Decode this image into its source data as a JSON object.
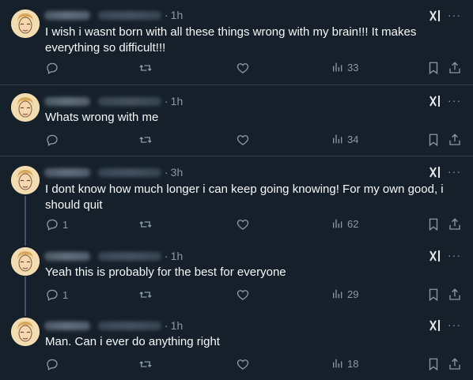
{
  "feed": {
    "posts": [
      {
        "time": "1h",
        "text": "I wish i wasnt born with all these things wrong with my brain!!! It makes everything so difficult!!!",
        "replies": "",
        "views": "33"
      },
      {
        "time": "1h",
        "text": "Whats wrong with me",
        "replies": "",
        "views": "34"
      },
      {
        "time": "3h",
        "text": "I dont know how much longer i can keep going knowing! For my own good, i should quit",
        "replies": "1",
        "views": "62"
      },
      {
        "time": "1h",
        "text": "Yeah this is probably for the best for everyone",
        "replies": "1",
        "views": "29"
      },
      {
        "time": "1h",
        "text": "Man. Can i ever do anything right",
        "replies": "",
        "views": "18"
      }
    ],
    "separator": "·",
    "more_glyph": "···"
  },
  "icons": {
    "reply": "reply-icon",
    "repost": "repost-icon",
    "like": "like-icon",
    "views": "views-icon",
    "bookmark": "bookmark-icon",
    "share": "share-icon",
    "grok": "grok-icon",
    "more": "more-icon"
  },
  "colors": {
    "background": "#15202b",
    "text": "#f7f9f9",
    "muted": "#8b98a5",
    "divider": "#38444d"
  }
}
